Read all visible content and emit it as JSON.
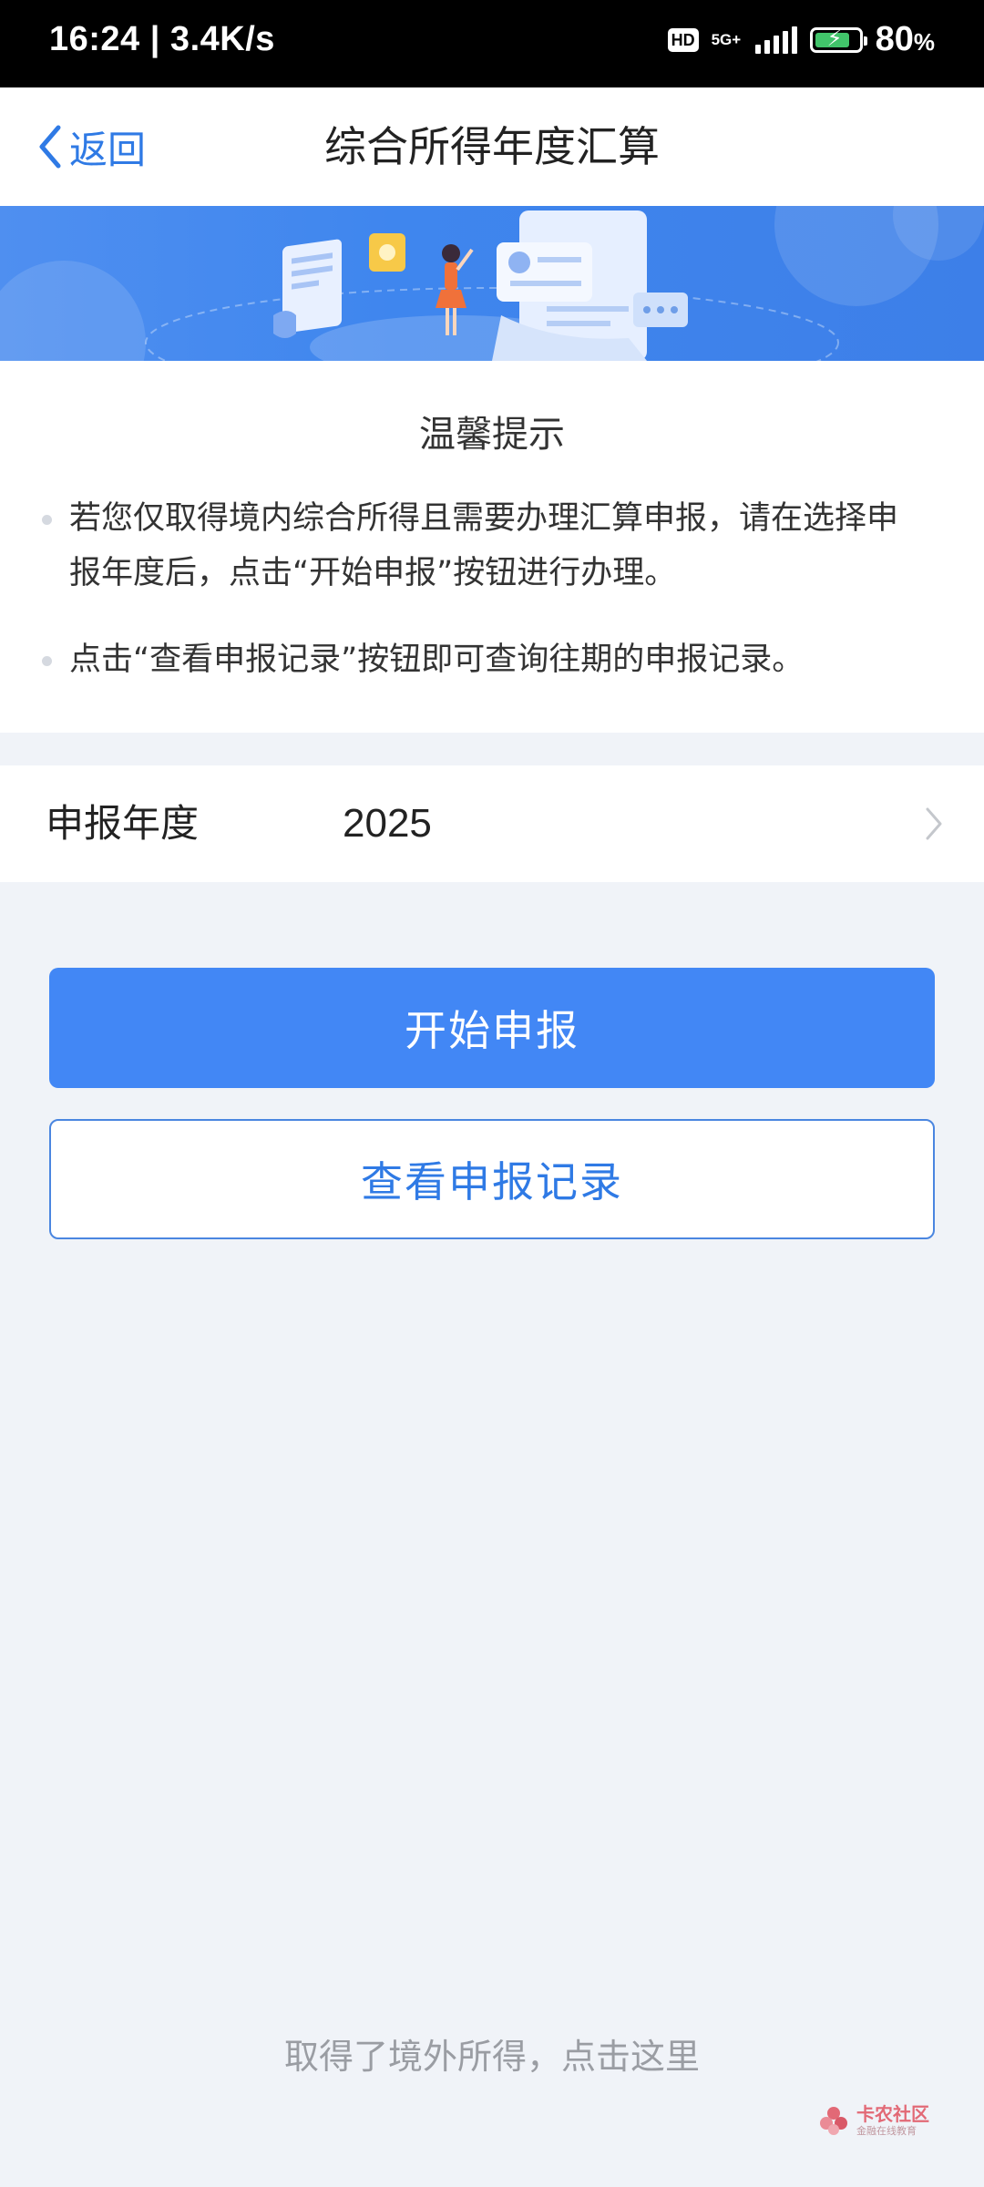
{
  "status_bar": {
    "time_speed": "16:24 | 3.4K/s",
    "hd": "HD",
    "network": "5G+",
    "battery_level": 0.8,
    "battery_percent": "80",
    "battery_unit": "%"
  },
  "nav": {
    "back_label": "返回",
    "title": "综合所得年度汇算"
  },
  "tips": {
    "title": "温馨提示",
    "items": [
      "若您仅取得境内综合所得且需要办理汇算申报，请在选择申报年度后，点击“开始申报”按钮进行办理。",
      "点击“查看申报记录”按钮即可查询往期的申报记录。"
    ]
  },
  "year_row": {
    "label": "申报年度",
    "value": "2025"
  },
  "buttons": {
    "start": "开始申报",
    "records": "查看申报记录"
  },
  "footer": {
    "foreign_income_link": "取得了境外所得，点击这里"
  },
  "watermark": {
    "main": "卡农社区",
    "sub": "金融在线教育"
  },
  "colors": {
    "accent": "#4287f5",
    "link": "#2f7ae5",
    "background": "#f0f3f8"
  }
}
